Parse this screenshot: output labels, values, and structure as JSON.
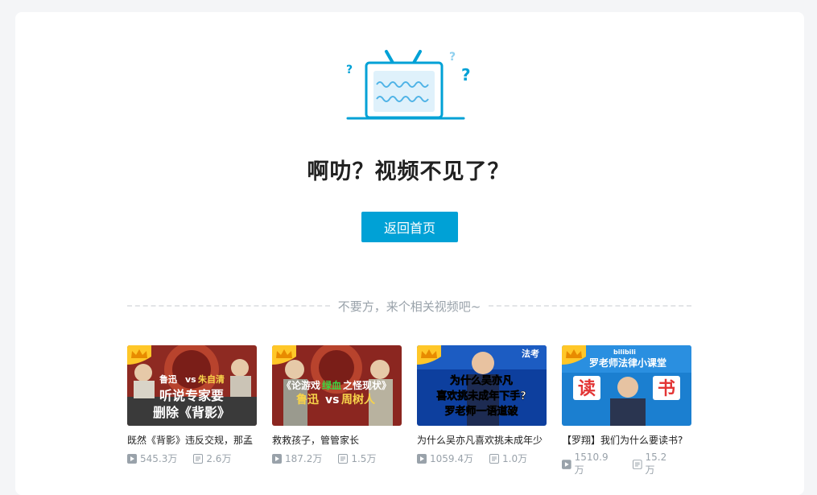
{
  "error": {
    "title": "啊叻？视频不见了？",
    "home_button": "返回首页"
  },
  "related": {
    "divider_text": "不要方，来个相关视频吧~",
    "videos": [
      {
        "title": "既然《背影》违反交规，那孟",
        "plays": "545.3万",
        "comments": "2.6万",
        "thumb_lines": [
          "鲁迅",
          "vs",
          "朱自清",
          "听说专家要",
          "删除《背影》"
        ]
      },
      {
        "title": "救救孩子，管管家长",
        "plays": "187.2万",
        "comments": "1.5万",
        "thumb_lines": [
          "《论游戏",
          "绿血",
          "之怪现状》",
          "鲁迅",
          "vs",
          "周树人"
        ]
      },
      {
        "title": "为什么吴亦凡喜欢挑未成年少",
        "plays": "1059.4万",
        "comments": "1.0万",
        "thumb_lines": [
          "为什么吴亦凡",
          "喜欢挑未成年下手?",
          "罗老师一语道破",
          "法考"
        ]
      },
      {
        "title": "【罗翔】我们为什么要读书?",
        "plays": "1510.9万",
        "comments": "15.2万",
        "thumb_lines": [
          "bilibili",
          "罗老师法律小课堂",
          "读",
          "书"
        ]
      }
    ]
  },
  "colors": {
    "accent": "#00a1d6",
    "text": "#212121",
    "muted": "#99a2aa"
  }
}
